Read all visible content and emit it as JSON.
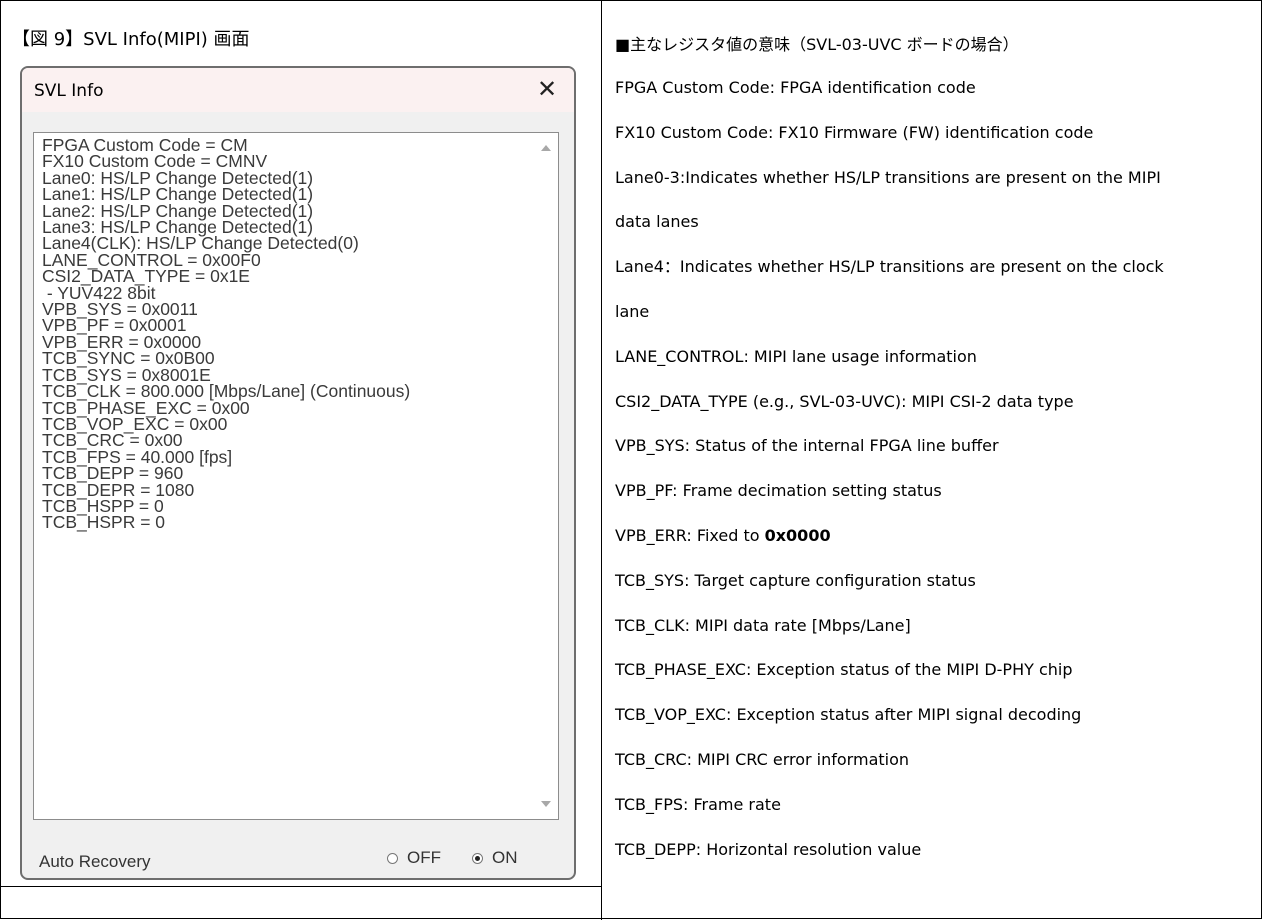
{
  "figure_title": "【図 9】SVL Info(MIPI) 画面",
  "dialog": {
    "title": "SVL Info",
    "close_glyph": "✕",
    "lines": [
      "FPGA Custom Code = CM",
      "FX10 Custom Code = CMNV",
      "Lane0: HS/LP Change Detected(1)",
      "Lane1: HS/LP Change Detected(1)",
      "Lane2: HS/LP Change Detected(1)",
      "Lane3: HS/LP Change Detected(1)",
      "Lane4(CLK): HS/LP Change Detected(0)",
      "LANE_CONTROL = 0x00F0",
      "CSI2_DATA_TYPE = 0x1E",
      " - YUV422 8bit",
      "VPB_SYS = 0x0011",
      "VPB_PF = 0x0001",
      "VPB_ERR = 0x0000",
      "TCB_SYNC = 0x0B00",
      "TCB_SYS = 0x8001E",
      "TCB_CLK = 800.000 [Mbps/Lane] (Continuous)",
      "TCB_PHASE_EXC = 0x00",
      "TCB_VOP_EXC = 0x00",
      "TCB_CRC = 0x00",
      "TCB_FPS = 40.000 [fps]",
      "TCB_DEPP = 960",
      "TCB_DEPR = 1080",
      "TCB_HSPP = 0",
      "TCB_HSPR = 0"
    ],
    "auto_recovery_label": "Auto Recovery",
    "off_label": "OFF",
    "on_label": "ON",
    "auto_recovery_value": "ON"
  },
  "right_column": {
    "heading": "■主なレジスタ値の意味（SVL-03-UVC ボードの場合）",
    "lines": [
      {
        "text": "FPGA Custom Code: FPGA identification code"
      },
      {
        "text": "FX10 Custom Code: FX10 Firmware (FW) identification code"
      },
      {
        "text": "Lane0-3:Indicates whether HS/LP transitions are present on the MIPI"
      },
      {
        "text": "data lanes"
      },
      {
        "text": "Lane4：Indicates whether HS/LP transitions are present on the clock"
      },
      {
        "text": "lane"
      },
      {
        "text": "LANE_CONTROL: MIPI lane usage information"
      },
      {
        "text": "CSI2_DATA_TYPE (e.g., SVL-03-UVC): MIPI CSI-2 data type"
      },
      {
        "text": "VPB_SYS: Status of the internal FPGA line buffer"
      },
      {
        "text": "VPB_PF: Frame decimation setting status"
      },
      {
        "text": "VPB_ERR: Fixed to ",
        "bold": "0x0000"
      },
      {
        "text": "TCB_SYS: Target capture configuration status"
      },
      {
        "text": "TCB_CLK: MIPI data rate [Mbps/Lane]"
      },
      {
        "text": "TCB_PHASE_EXC: Exception status of the MIPI D-PHY chip"
      },
      {
        "text": "TCB_VOP_EXC: Exception status after MIPI signal decoding"
      },
      {
        "text": "TCB_CRC: MIPI CRC error information"
      },
      {
        "text": "TCB_FPS: Frame rate"
      },
      {
        "text": "TCB_DEPP: Horizontal resolution value"
      }
    ]
  }
}
